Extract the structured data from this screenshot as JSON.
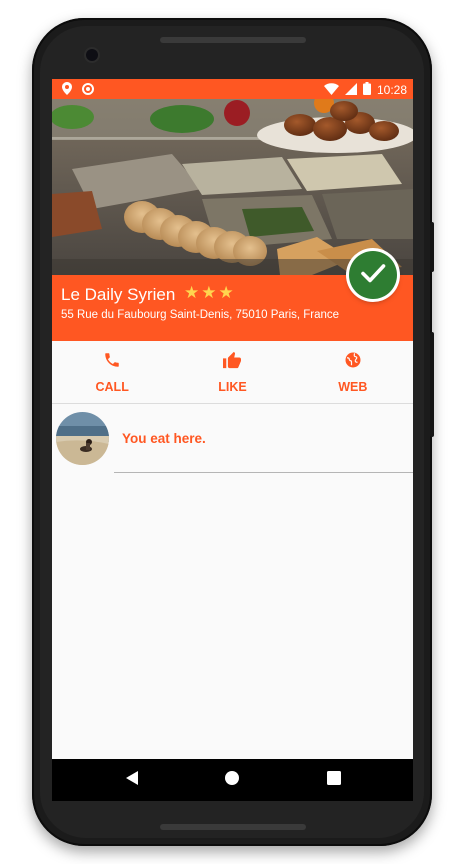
{
  "status_bar": {
    "time": "10:28",
    "icons": [
      "location-icon",
      "circle-notification-icon",
      "wifi-icon",
      "signal-icon",
      "battery-icon"
    ]
  },
  "restaurant": {
    "name": "Le Daily Syrien",
    "stars": "★★★",
    "rating": 3,
    "address": "55 Rue du Faubourg Saint-Denis, 75010 Paris, France"
  },
  "actions": [
    {
      "label": "CALL",
      "icon": "phone-icon"
    },
    {
      "label": "LIKE",
      "icon": "thumb-up-icon"
    },
    {
      "label": "WEB",
      "icon": "globe-icon"
    }
  ],
  "list": {
    "items": [
      {
        "text": "You eat here."
      }
    ]
  },
  "colors": {
    "accent": "#ff5722",
    "check": "#2e7d32",
    "star": "#ffd54f"
  },
  "navigation": [
    "back-icon",
    "home-icon",
    "recents-icon"
  ]
}
